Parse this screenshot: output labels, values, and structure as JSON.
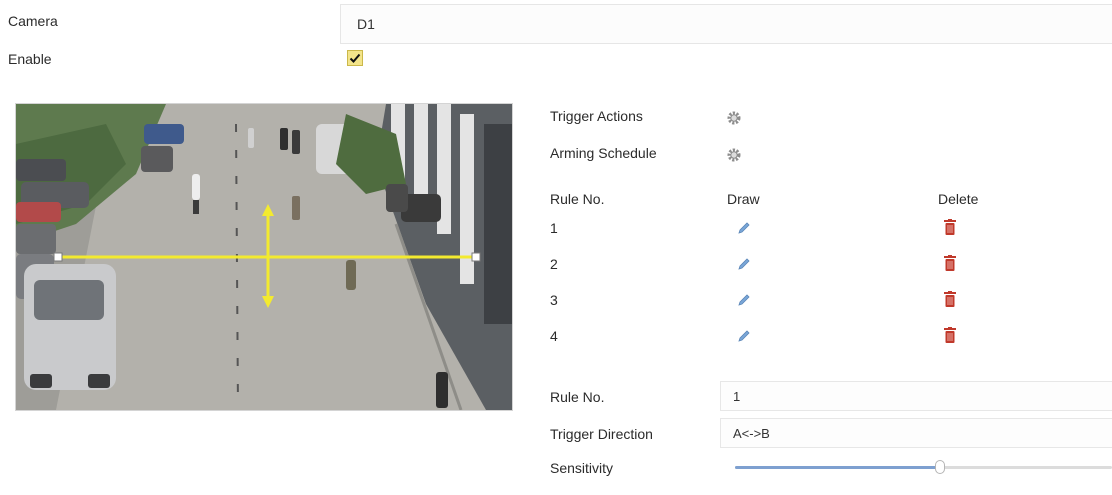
{
  "form": {
    "camera_label": "Camera",
    "camera_value": "D1",
    "enable_label": "Enable",
    "enable_checked": true
  },
  "panel": {
    "trigger_actions_label": "Trigger Actions",
    "arming_schedule_label": "Arming Schedule",
    "table": {
      "col_rule": "Rule No.",
      "col_draw": "Draw",
      "col_delete": "Delete",
      "rows": [
        {
          "no": "1"
        },
        {
          "no": "2"
        },
        {
          "no": "3"
        },
        {
          "no": "4"
        }
      ]
    },
    "rule_no_label": "Rule No.",
    "rule_no_value": "1",
    "trigger_direction_label": "Trigger Direction",
    "trigger_direction_value": "A<->B",
    "sensitivity_label": "Sensitivity",
    "sensitivity_level": 0.545
  },
  "colors": {
    "checkbox": "#f3e48a",
    "tripwire": "#f3ea2f",
    "trash": "#c0392b",
    "pencil": "#7aa7d8",
    "slider_fill": "#7ea0d0"
  },
  "icons": {
    "settings": "gear-icon",
    "draw": "pencil-icon",
    "delete": "trash-icon",
    "enabled": "checkmark-icon"
  }
}
